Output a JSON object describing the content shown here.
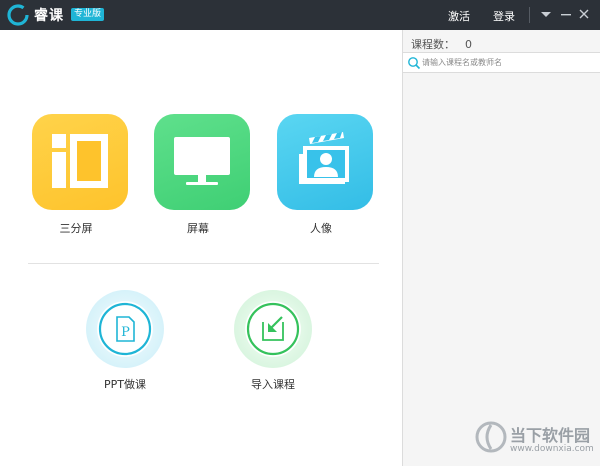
{
  "titlebar": {
    "app_name": "睿课",
    "edition_badge": "专业版",
    "activate_label": "激活",
    "login_label": "登录",
    "menu_icon": "dropdown-triangle-icon",
    "minimize_icon": "minimize-icon",
    "close_icon": "close-icon"
  },
  "main": {
    "modes": [
      {
        "label": "三分屏",
        "icon": "three-split-screen-icon",
        "color": "#fec32c"
      },
      {
        "label": "屏幕",
        "icon": "monitor-icon",
        "color": "#44d279"
      },
      {
        "label": "人像",
        "icon": "portrait-camera-icon",
        "color": "#38c2ea"
      }
    ],
    "actions": [
      {
        "label": "PPT做课",
        "icon": "ppt-file-icon",
        "color": "#1fb5d6"
      },
      {
        "label": "导入课程",
        "icon": "import-course-icon",
        "color": "#35c25c"
      }
    ]
  },
  "panel": {
    "course_count_label": "课程数：",
    "course_count_value": "0",
    "search_placeholder": "请输入课程名或教师名"
  },
  "watermark": {
    "text": "当下软件园",
    "url": "www.downxia.com"
  }
}
